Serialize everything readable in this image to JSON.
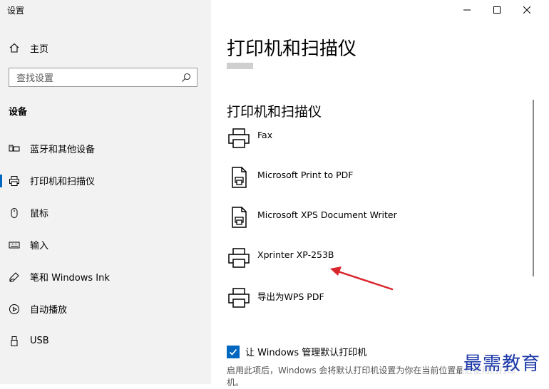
{
  "window": {
    "title": "设置",
    "controls": [
      "minimize-icon",
      "maximize-icon",
      "close-icon"
    ]
  },
  "sidebar": {
    "home_label": "主页",
    "search_placeholder": "查找设置",
    "section_heading": "设备",
    "items": [
      {
        "label": "蓝牙和其他设备",
        "icon": "bluetooth-devices-icon"
      },
      {
        "label": "打印机和扫描仪",
        "icon": "printer-icon",
        "active": true
      },
      {
        "label": "鼠标",
        "icon": "mouse-icon"
      },
      {
        "label": "输入",
        "icon": "keyboard-icon"
      },
      {
        "label": "笔和 Windows Ink",
        "icon": "pen-icon"
      },
      {
        "label": "自动播放",
        "icon": "autoplay-icon"
      },
      {
        "label": "USB",
        "icon": "usb-icon"
      }
    ]
  },
  "main": {
    "page_title": "打印机和扫描仪",
    "section_title": "打印机和扫描仪",
    "printers": [
      {
        "name": "Fax",
        "icon": "printer-icon"
      },
      {
        "name": "Microsoft Print to PDF",
        "icon": "document-printer-icon"
      },
      {
        "name": "Microsoft XPS Document Writer",
        "icon": "document-printer-icon"
      },
      {
        "name": "Xprinter XP-253B",
        "icon": "printer-icon"
      },
      {
        "name": "导出为WPS PDF",
        "icon": "printer-icon"
      }
    ],
    "default_printer_checkbox_label": "让 Windows 管理默认打印机",
    "default_printer_checked": true,
    "description": "启用此项后，Windows 会将默认打印机设置为你在当前位置最近使用的打印机。"
  },
  "watermark": "最需教育",
  "colors": {
    "accent": "#0067c0",
    "sidebar_bg": "#f2f2f2",
    "annotation_arrow": "#d9262c",
    "watermark": "#1e3aa8"
  }
}
